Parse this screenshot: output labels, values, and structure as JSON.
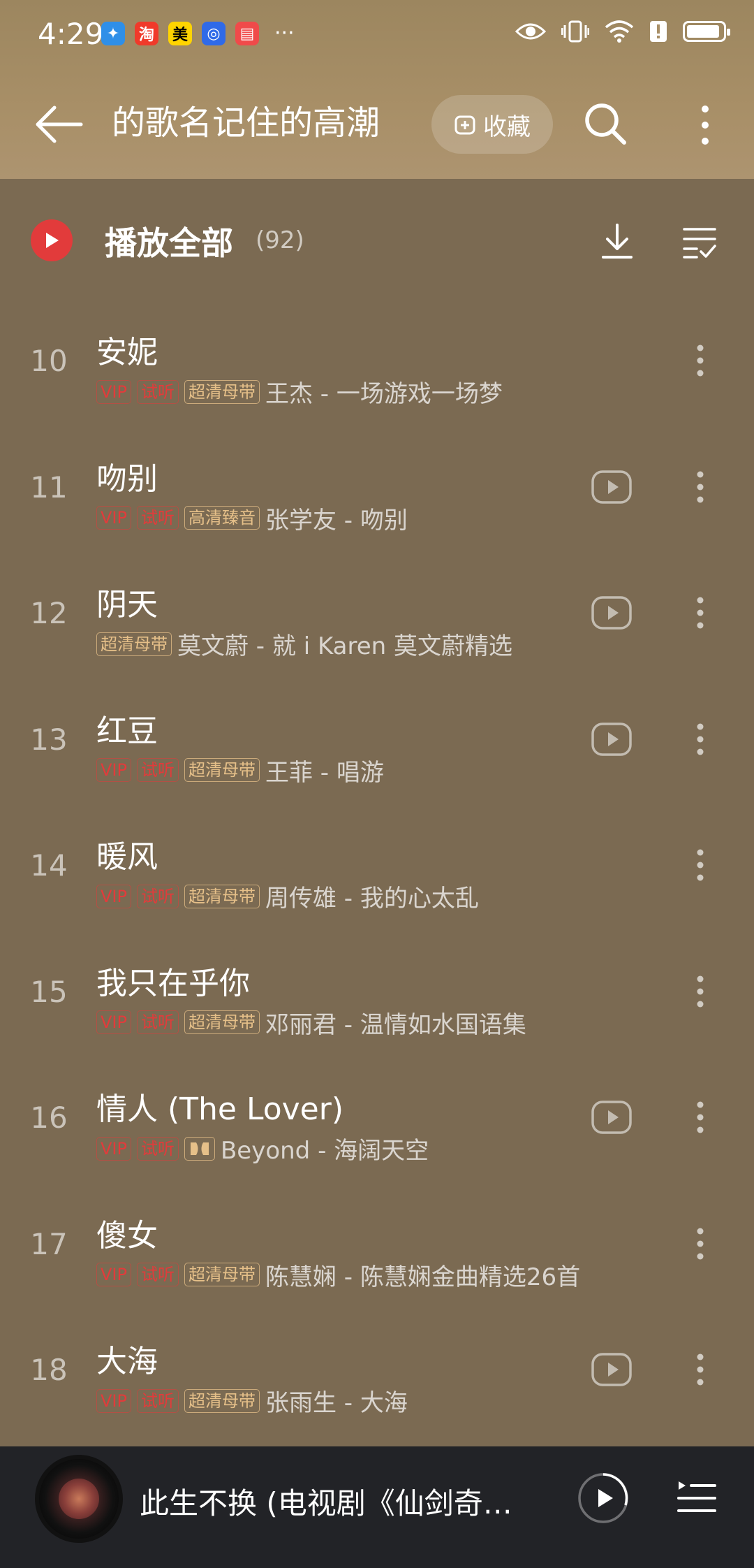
{
  "status": {
    "time": "4:29",
    "more": "···",
    "app_icons": [
      {
        "name": "bird-app-icon",
        "color": "#2f8fe8",
        "glyph": "✦"
      },
      {
        "name": "taobao-app-icon",
        "color": "#f03a2a",
        "glyph": "淘"
      },
      {
        "name": "meituan-app-icon",
        "color": "#ffd400",
        "glyph": "美"
      },
      {
        "name": "bulb-app-icon",
        "color": "#2f6ae8",
        "glyph": "◎"
      },
      {
        "name": "red-app-icon",
        "color": "#f04a4a",
        "glyph": "▤"
      }
    ]
  },
  "nav": {
    "title": "的歌名记住的高潮",
    "collect_label": "收藏"
  },
  "playall": {
    "label": "播放全部",
    "count": "(92)"
  },
  "songs": [
    {
      "index": "10",
      "title": "安妮",
      "vip": "VIP",
      "trial": "试听",
      "quality": "超清母带",
      "meta": "王杰 - 一场游戏一场梦",
      "mv": false
    },
    {
      "index": "11",
      "title": "吻别",
      "vip": "VIP",
      "trial": "试听",
      "quality": "高清臻音",
      "meta": "张学友 - 吻别",
      "mv": true
    },
    {
      "index": "12",
      "title": "阴天",
      "vip": "",
      "trial": "",
      "quality": "超清母带",
      "meta": "莫文蔚 - 就 i Karen 莫文蔚精选",
      "mv": true
    },
    {
      "index": "13",
      "title": "红豆",
      "vip": "VIP",
      "trial": "试听",
      "quality": "超清母带",
      "meta": "王菲 - 唱游",
      "mv": true
    },
    {
      "index": "14",
      "title": "暖风",
      "vip": "VIP",
      "trial": "试听",
      "quality": "超清母带",
      "meta": "周传雄 - 我的心太乱",
      "mv": false
    },
    {
      "index": "15",
      "title": "我只在乎你",
      "vip": "VIP",
      "trial": "试听",
      "quality": "超清母带",
      "meta": "邓丽君 - 温情如水国语集",
      "mv": false
    },
    {
      "index": "16",
      "title": "情人 (The Lover)",
      "vip": "VIP",
      "trial": "试听",
      "quality": "dolby",
      "meta": "Beyond - 海阔天空",
      "mv": true
    },
    {
      "index": "17",
      "title": "傻女",
      "vip": "VIP",
      "trial": "试听",
      "quality": "超清母带",
      "meta": "陈慧娴 - 陈慧娴金曲精选26首",
      "mv": false
    },
    {
      "index": "18",
      "title": "大海",
      "vip": "VIP",
      "trial": "试听",
      "quality": "超清母带",
      "meta": "张雨生 - 大海",
      "mv": true
    }
  ],
  "miniplayer": {
    "title": "此生不换 (电视剧《仙剑奇…"
  },
  "colors": {
    "background": "#7b6a52",
    "header": "#a88f67",
    "accent_red": "#e23b3b",
    "quality_gold": "#e6c089",
    "miniplayer_bg": "#222327"
  }
}
